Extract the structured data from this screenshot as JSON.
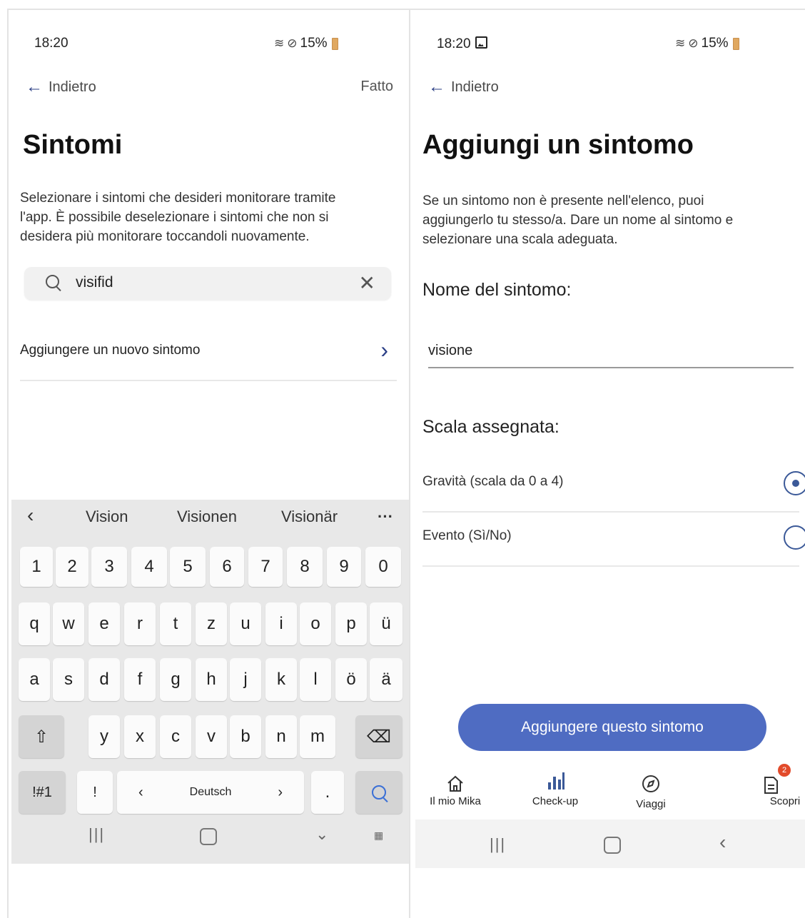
{
  "left": {
    "status": {
      "time": "18:20",
      "battery": "15%"
    },
    "nav": {
      "back": "Indietro",
      "done": "Fatto"
    },
    "title": "Sintomi",
    "description_lines": [
      "Selezionare i sintomi che desideri monitorare tramite",
      "l'app. È possibile deselezionare i sintomi che non si",
      "desidera più monitorare toccandoli nuovamente."
    ],
    "search": {
      "value": "visifid"
    },
    "add_row": {
      "label": "Aggiungere un nuovo sintomo"
    },
    "keyboard": {
      "suggestions": [
        "Vision",
        "Visionen",
        "Visionär"
      ],
      "more": "···",
      "row_numbers": [
        "1",
        "2",
        "3",
        "4",
        "5",
        "6",
        "7",
        "8",
        "9",
        "0"
      ],
      "row1": [
        "q",
        "w",
        "e",
        "r",
        "t",
        "z",
        "u",
        "i",
        "o",
        "p",
        "ü"
      ],
      "row2": [
        "a",
        "s",
        "d",
        "f",
        "g",
        "h",
        "j",
        "k",
        "l",
        "ö",
        "ä"
      ],
      "row3": [
        "y",
        "x",
        "c",
        "v",
        "b",
        "n",
        "m"
      ],
      "symbols": "!#1",
      "excl": "!",
      "lang_left": "‹",
      "language": "Deutsch",
      "lang_right": "›",
      "period": "."
    }
  },
  "right": {
    "status": {
      "time": "18:20",
      "battery": "15%"
    },
    "nav": {
      "back": "Indietro"
    },
    "title": "Aggiungi un sintomo",
    "description_lines": [
      "Se un sintomo non è presente nell'elenco, puoi",
      "aggiungerlo tu stesso/a. Dare un nome al sintomo e",
      "selezionare una scala adeguata."
    ],
    "name_label": "Nome del sintomo:",
    "name_value": "visione",
    "scale_label": "Scala assegnata:",
    "options": [
      {
        "label": "Gravità (scala da 0 a 4)",
        "selected": true
      },
      {
        "label": "Evento (Sì/No)",
        "selected": false
      }
    ],
    "cta": "Aggiungere questo sintomo",
    "tabs": [
      {
        "label": "Il mio Mika",
        "icon": "home-icon"
      },
      {
        "label": "Check-up",
        "icon": "bar-chart-icon"
      },
      {
        "label": "Viaggi",
        "icon": "compass-icon"
      },
      {
        "label": "Scopri",
        "icon": "document-icon",
        "badge": "2"
      }
    ]
  },
  "colors": {
    "accent": "#4f6cc2",
    "badge": "#e24b2b",
    "radio": "#3b5998"
  }
}
